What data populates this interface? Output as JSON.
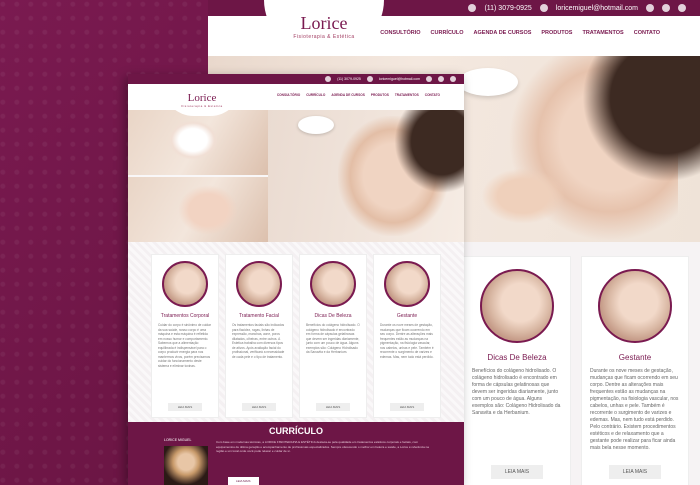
{
  "brand": {
    "name": "Lorice",
    "tagline": "Fisioterapia & Estética"
  },
  "contact": {
    "phone": "(11) 3079-0925",
    "email": "loricemiguel@hotmail.com"
  },
  "menu": [
    "CONSULTÓRIO",
    "CURRÍCULO",
    "AGENDA DE CURSOS",
    "PRODUTOS",
    "TRATAMENTOS",
    "CONTATO"
  ],
  "back_cards": [
    {
      "title": "Dicas De Beleza",
      "text": "Benefícios do colágeno hidrolisado. O colágeno hidrolisado é encontrado em forma de cápsulas gelatinosas que devem ser ingeridas diariamente, junto com um pouco de água. Alguns exemplos são: Colágeno Hidrolisado da Sanavita e da Herbanium.",
      "button": "LEIA MAIS"
    },
    {
      "title": "Gestante",
      "text": "Durante os nove meses de gestação, mudanças que ficam ocorrendo em seu corpo. Dentre as alterações mais frequentes estão as mudanças na pigmentação, na fisiologia vascular, nos cabelos, unhas e pele. Também é recorrente o surgimento de varizes e edemas. Mas, nem tudo está perdido. Pelo contrário. Existem procedimentos estéticos e de relaxamento que a gestante pode realizar para ficar ainda mais bela nesse momento.",
      "button": "LEIA MAIS"
    }
  ],
  "front_cards": [
    {
      "title": "Tratamentos Corporal",
      "text": "Cuidar do corpo é sinônimo de cuidar da sua saúde, nosso corpo é uma máquina e esta máquina é refletida em nosso humor e comportamento. Sabemos que a alimentação equilibrada é indispensável para o corpo produzir energia para nos mantermos vivos, porém precisamos cuidar do funcionamento deste sistema e eliminar toxinas.",
      "button": "LEIA MAIS"
    },
    {
      "title": "Tratamento Facial",
      "text": "Os tratamentos faciais são indicados para flacidez, rugas, linhas de expressão, manchas, acne, poros dilatados, olheiras, entre outros. A Estetica trabalha com diversos tipos de ativos. Após avaliação facial do profissional, verificará a necessidade de cada pele e o tipo de tratamento.",
      "button": "LEIA MAIS"
    },
    {
      "title": "Dicas De Beleza",
      "text": "Benefícios do colágeno hidrolisado. O colágeno hidrolisado é encontrado em forma de cápsulas gelatinosas que devem ser ingeridas diariamente, junto com um pouco de água. Alguns exemplos são: Colágeno Hidrolisado da Sanavita e da Herbanium.",
      "button": "LEIA MAIS"
    },
    {
      "title": "Gestante",
      "text": "Durante os nove meses de gestação, mudanças que ficam ocorrendo em seu corpo. Dentre as alterações mais frequentes estão as mudanças na pigmentação, na fisiologia vascular, nos cabelos, unhas e pele. Também é recorrente o surgimento de varizes e edemas. Mas, nem tudo está perdido.",
      "button": "LEIA MAIS"
    }
  ],
  "curriculo": {
    "title": "CURRÍCULO",
    "name": "LORICE MIGUEL",
    "text": "Com base em modernas técnicas, a LORICE FISIOTERAPIA E ESTÉTICA destaca-se pela qualidade em tratamentos estéticos corporais e faciais, com equipamentos de última geração e acompanhamento de profissionais especializados. Sempre oferecendo o melhor em beleza e saúde, a Lorice é referência na região e um local onde você pode relaxar e cuidar de si.",
    "button": "LEIA MAIS"
  }
}
